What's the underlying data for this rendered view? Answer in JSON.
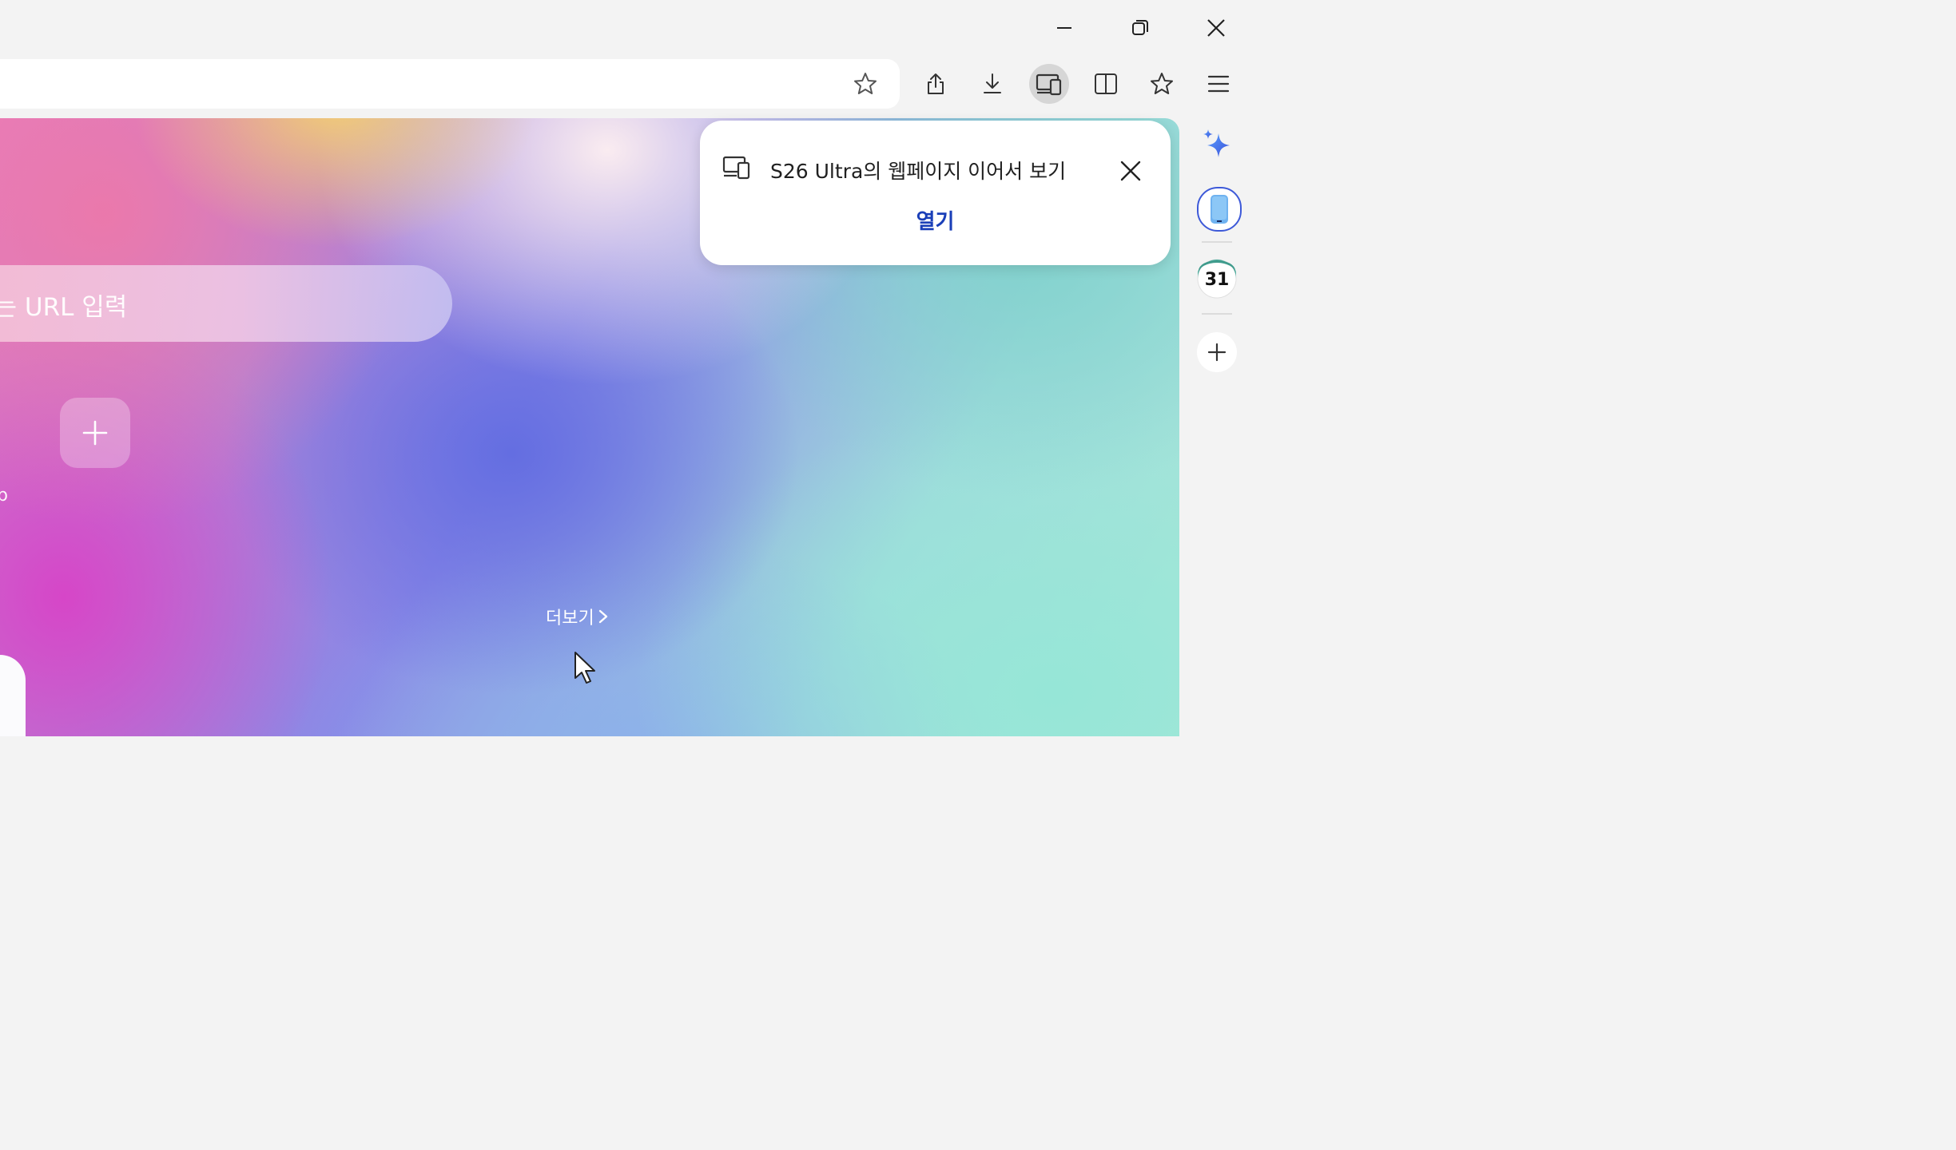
{
  "window": {
    "minimize_icon": "minimize-icon",
    "restore_icon": "restore-icon",
    "close_icon": "close-icon"
  },
  "toolbar": {
    "bookmark_star_icon": "star-icon",
    "buttons": [
      "share-icon",
      "download-icon",
      "continue-on-device-icon",
      "split-view-icon",
      "bookmarks-icon",
      "menu-icon"
    ],
    "active_button": "continue-on-device-icon"
  },
  "newtab": {
    "search_placeholder": "또는 URL 입력",
    "add_shortcut_icon": "plus-icon",
    "tile_label": "p",
    "more_link": "더보기",
    "more_chevron": "chevron-right-icon"
  },
  "popup": {
    "message": "S26 Ultra의 웹페이지 이어서 보기",
    "open_button": "열기",
    "accent": "#1a3fb8"
  },
  "sidebar": {
    "ai_icon": "sparkle-icon",
    "phone_icon": "phone-icon",
    "calendar_day": "31",
    "add_icon": "plus-icon"
  }
}
